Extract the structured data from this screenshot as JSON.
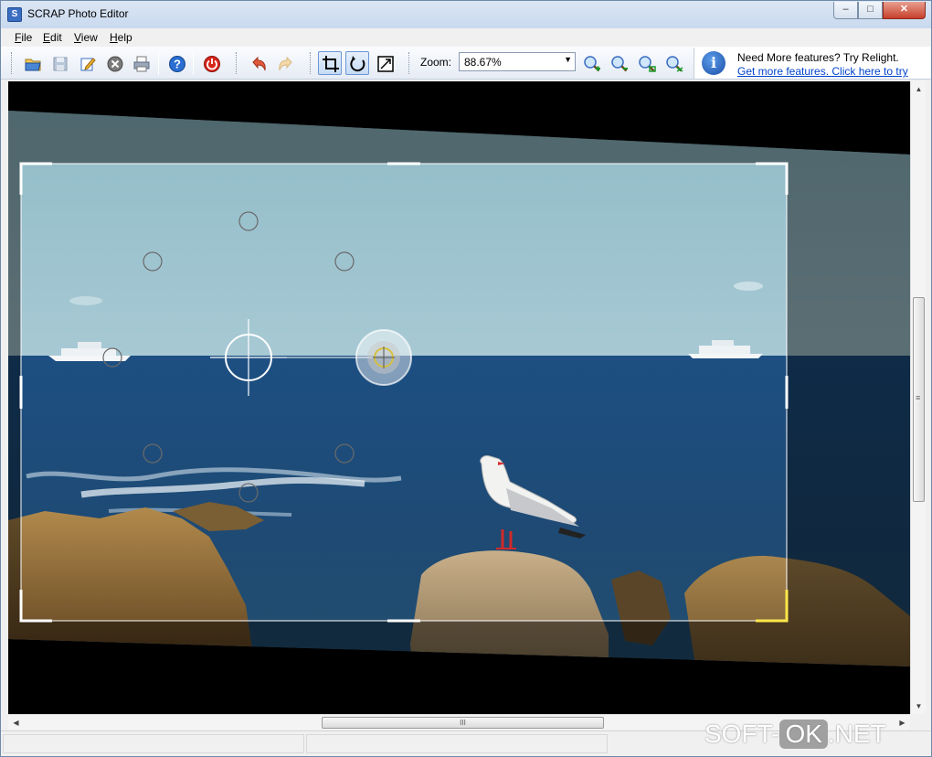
{
  "window": {
    "title": "SCRAP Photo Editor",
    "minimize_label": "–",
    "maximize_label": "□",
    "close_label": "✕"
  },
  "menu": {
    "items": [
      {
        "accel": "F",
        "rest": "ile"
      },
      {
        "accel": "E",
        "rest": "dit"
      },
      {
        "accel": "V",
        "rest": "iew"
      },
      {
        "accel": "H",
        "rest": "elp"
      }
    ]
  },
  "toolbar": {
    "buttons": [
      "open-icon",
      "save-icon",
      "edit-icon",
      "close-image-icon",
      "print-icon",
      "help-icon",
      "exit-icon",
      "undo-icon",
      "redo-icon",
      "crop-icon",
      "rotate-icon",
      "resize-icon"
    ],
    "active_tools": [
      "crop-icon",
      "rotate-icon"
    ],
    "zoom_label": "Zoom:",
    "zoom_value": "88.67%",
    "zoom_buttons": [
      "zoom-in-icon",
      "zoom-out-icon",
      "zoom-fit-icon",
      "zoom-actual-icon"
    ]
  },
  "info": {
    "title": "Need More features? Try Relight.",
    "link": "Get more features. Click here to try"
  },
  "colors": {
    "accent": "#1b4fa8",
    "link": "#0044cc",
    "crop_corner_highlight": "#ffe84a",
    "exit_red": "#d8261c"
  },
  "scroll": {
    "horizontal_thumb_label": "III",
    "vertical_thumb_label": "≡"
  },
  "watermark": {
    "prefix": "SOFT-",
    "highlight": "OK",
    "suffix": ".NET"
  }
}
